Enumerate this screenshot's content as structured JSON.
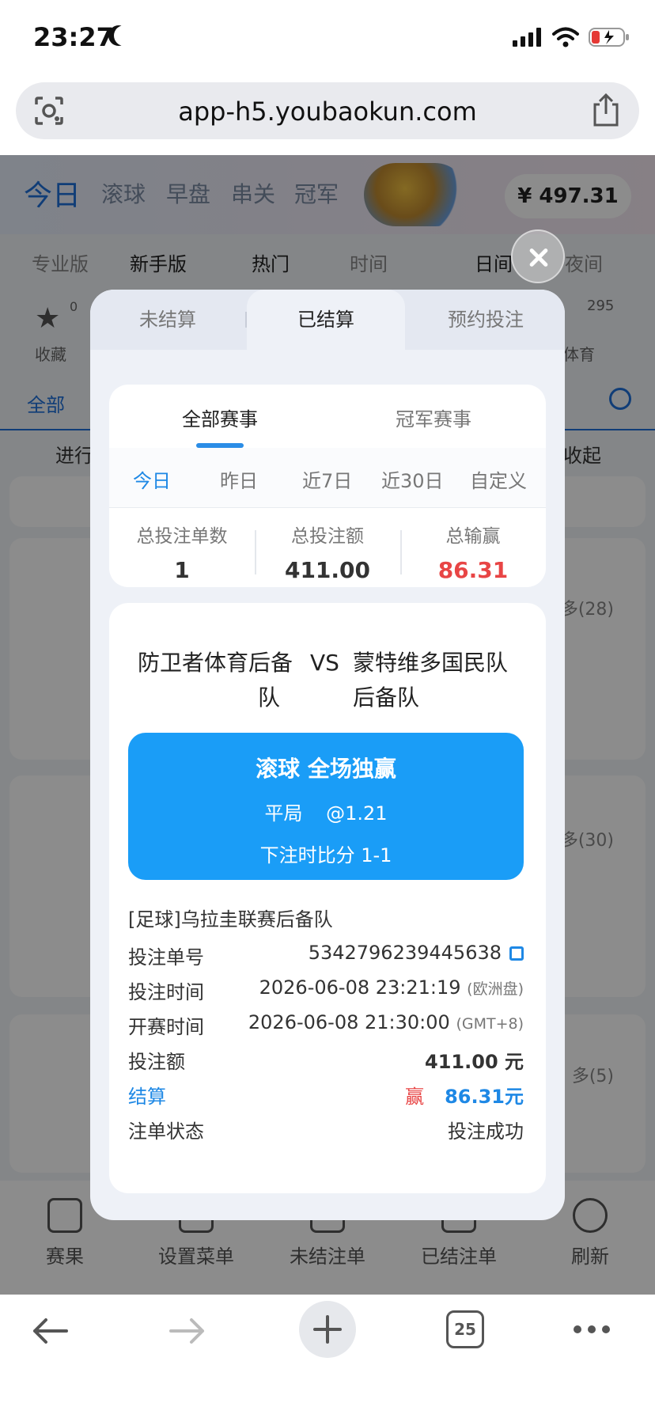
{
  "status_bar": {
    "time": "23:27"
  },
  "browser": {
    "url": "app-h5.youbaokun.com",
    "tabs_count": "25"
  },
  "background": {
    "nav_tabs": [
      "今日",
      "滚球",
      "早盘",
      "串关",
      "冠军"
    ],
    "balance": "¥ 497.31",
    "mode_tabs": [
      "专业版",
      "新手版",
      "热门",
      "时间",
      "日间",
      "夜间"
    ],
    "fav_label": "收藏",
    "fav_count": "0",
    "sport_count": "295",
    "sport_label": "体育",
    "all_label": "全部",
    "inplay_label": "进行",
    "collapse_label": "收起",
    "more_28": "多(28)",
    "more_30": "多(30)",
    "more_5": "多(5)",
    "bottom_nav": [
      "赛果",
      "设置菜单",
      "未结注单",
      "已结注单",
      "刷新"
    ]
  },
  "modal": {
    "tabs": [
      "未结算",
      "已结算",
      "预约投注"
    ],
    "subtabs": [
      "全部赛事",
      "冠军赛事"
    ],
    "days": [
      "今日",
      "昨日",
      "近7日",
      "近30日",
      "自定义"
    ],
    "stats": [
      {
        "label": "总投注单数",
        "value": "1"
      },
      {
        "label": "总投注额",
        "value": "411.00"
      },
      {
        "label": "总输赢",
        "value": "86.31"
      }
    ],
    "bet": {
      "home_line1": "防卫者体育后备",
      "home_line2": "队",
      "vs": "VS",
      "away_line1": "蒙特维多国民队",
      "away_line2": "后备队",
      "market": "滚球 全场独赢",
      "selection": "平局",
      "odds": "@1.21",
      "score_at_bet": "下注时比分 1-1",
      "league": "[足球]乌拉圭联赛后备队",
      "rows": {
        "order_no_label": "投注单号",
        "order_no": "5342796239445638",
        "bet_time_label": "投注时间",
        "bet_time": "2026-06-08 23:21:19",
        "bet_time_note": "(欧洲盘)",
        "start_time_label": "开赛时间",
        "start_time": "2026-06-08 21:30:00",
        "start_time_note": "(GMT+8)",
        "amount_label": "投注额",
        "amount": "411.00 元",
        "settle_label": "结算",
        "settle_result": "赢",
        "settle_amount": "86.31元",
        "status_label": "注单状态",
        "status": "投注成功"
      }
    }
  }
}
